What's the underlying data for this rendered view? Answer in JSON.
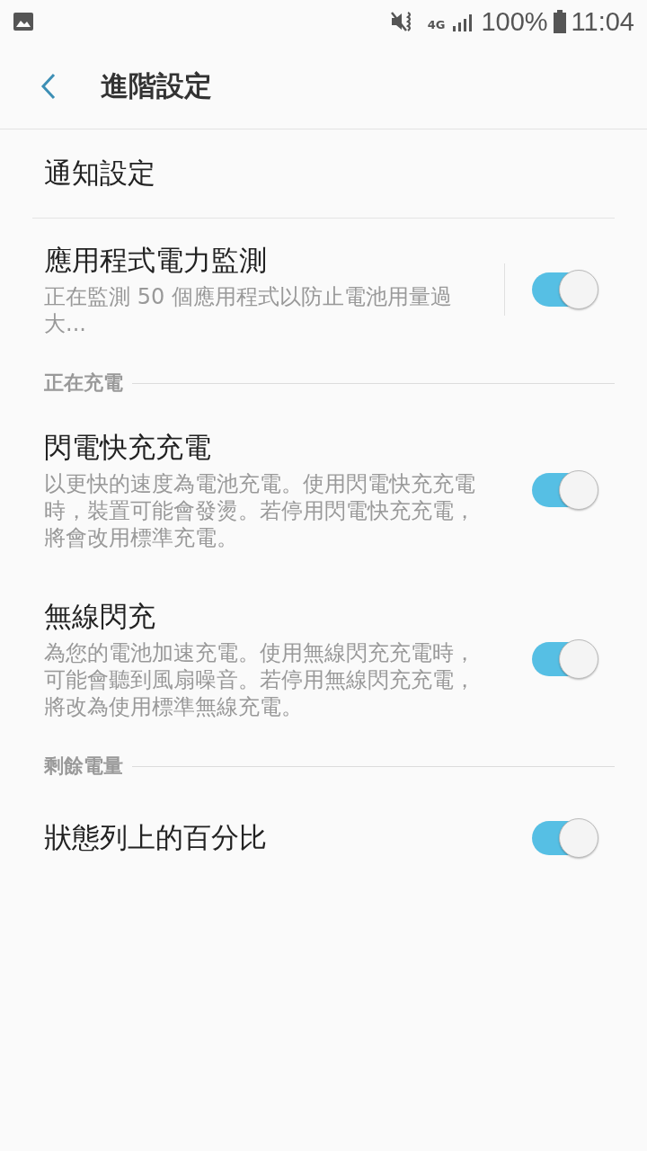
{
  "status_bar": {
    "battery": "100%",
    "time": "11:04",
    "network": "4G"
  },
  "app_bar": {
    "title": "進階設定"
  },
  "rows": [
    {
      "kind": "plain",
      "title": "通知設定",
      "divider": true
    },
    {
      "kind": "toggle",
      "title": "應用程式電力監測",
      "description": "正在監測 50 個應用程式以防止電池用量過大...",
      "on": true,
      "separated": true
    },
    {
      "kind": "header",
      "title": "正在充電"
    },
    {
      "kind": "toggle",
      "title": "閃電快充充電",
      "description": "以更快的速度為電池充電。使用閃電快充充電時，裝置可能會發燙。若停用閃電快充充電，將會改用標準充電。",
      "on": true,
      "separated": false
    },
    {
      "kind": "toggle",
      "title": "無線閃充",
      "description": "為您的電池加速充電。使用無線閃充充電時，可能會聽到風扇噪音。若停用無線閃充充電，將改為使用標準無線充電。",
      "on": true,
      "separated": false
    },
    {
      "kind": "header",
      "title": "剩餘電量"
    },
    {
      "kind": "toggle",
      "title": "狀態列上的百分比",
      "on": true,
      "separated": false
    }
  ]
}
